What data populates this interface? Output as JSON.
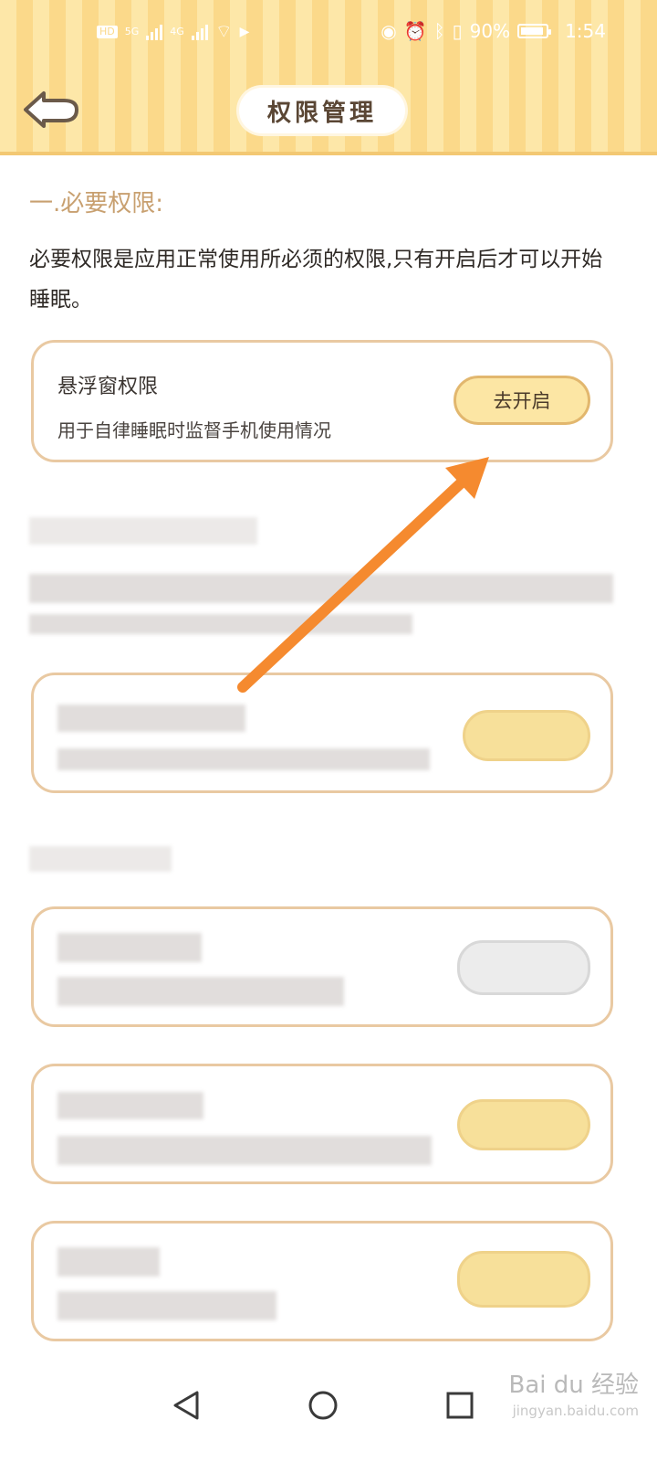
{
  "status_bar": {
    "network_left": "5G",
    "network_right": "4G",
    "battery_percent": "90%",
    "time": "1:54"
  },
  "header": {
    "title": "权限管理"
  },
  "section": {
    "title": "一.必要权限:",
    "description": "必要权限是应用正常使用所必须的权限,只有开启后才可以开始睡眠。"
  },
  "cards": [
    {
      "title": "悬浮窗权限",
      "subtitle": "用于自律睡眠时监督手机使用情况",
      "button_label": "去开启"
    }
  ],
  "watermark": {
    "brand": "Bai du 经验",
    "url": "jingyan.baidu.com"
  },
  "colors": {
    "accent": "#fbd98a",
    "button_bg": "#fce6a4",
    "card_border": "#e9c9a2",
    "arrow": "#f58a2f"
  },
  "icons": {
    "back": "back-arrow-icon",
    "nav_back": "triangle-back-icon",
    "nav_home": "circle-home-icon",
    "nav_recent": "square-recent-icon"
  }
}
